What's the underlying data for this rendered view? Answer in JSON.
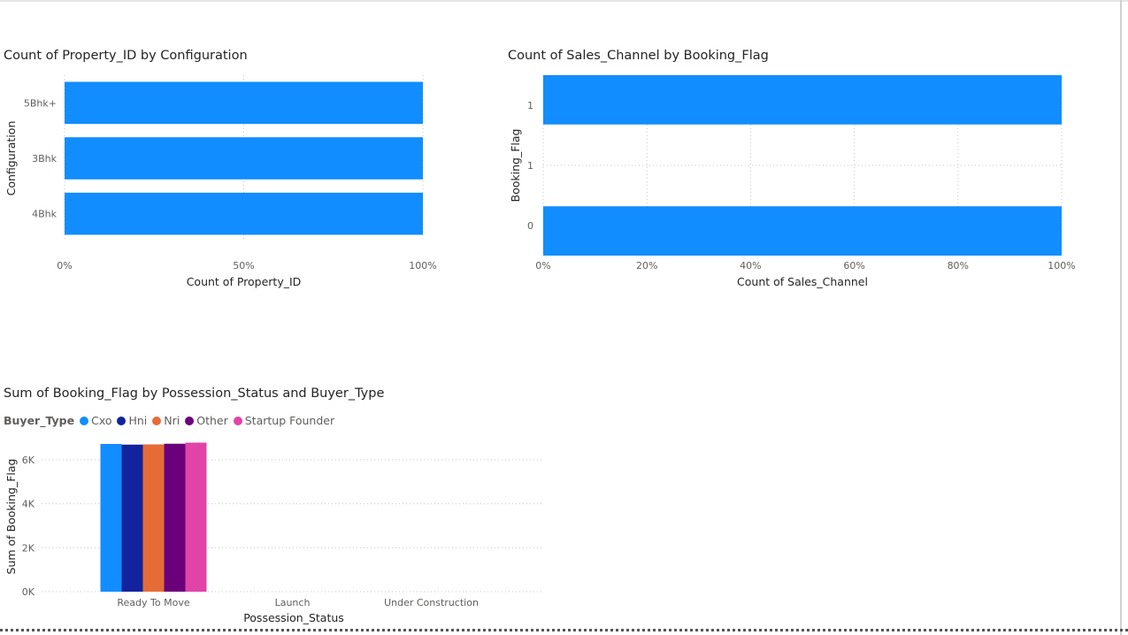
{
  "charts": {
    "c1": {
      "title": "Count of Property_ID by Configuration",
      "xlabel": "Count of Property_ID",
      "ylabel": "Configuration",
      "xticks": [
        "0%",
        "50%",
        "100%"
      ]
    },
    "c2": {
      "title": "Count of Sales_Channel by Booking_Flag",
      "xlabel": "Count of Sales_Channel",
      "ylabel": "Booking_Flag",
      "xticks": [
        "0%",
        "20%",
        "40%",
        "60%",
        "80%",
        "100%"
      ]
    },
    "c3": {
      "title": "Sum of Booking_Flag by Possession_Status and Buyer_Type",
      "xlabel": "Possession_Status",
      "ylabel": "Sum of Booking_Flag",
      "legend_title": "Buyer_Type",
      "yticks": [
        "0K",
        "2K",
        "4K",
        "6K"
      ]
    }
  },
  "chart_data": [
    {
      "type": "bar",
      "orientation": "horizontal",
      "title": "Count of Property_ID by Configuration",
      "xlabel": "Count of Property_ID",
      "ylabel": "Configuration",
      "categories": [
        "5Bhk+",
        "3Bhk",
        "4Bhk"
      ],
      "values": [
        100,
        100,
        100
      ],
      "unit": "%",
      "xlim": [
        0,
        100
      ],
      "color": "#118DFF",
      "grid": true
    },
    {
      "type": "bar",
      "orientation": "horizontal",
      "title": "Count of Sales_Channel by Booking_Flag",
      "xlabel": "Count of Sales_Channel",
      "ylabel": "Booking_Flag",
      "categories": [
        "1",
        "1",
        "0"
      ],
      "values": [
        100,
        null,
        100
      ],
      "unit": "%",
      "xlim": [
        0,
        100
      ],
      "color": "#118DFF",
      "grid": true
    },
    {
      "type": "bar",
      "orientation": "vertical",
      "title": "Sum of Booking_Flag by Possession_Status and Buyer_Type",
      "xlabel": "Possession_Status",
      "ylabel": "Sum of Booking_Flag",
      "categories": [
        "Ready To Move",
        "Launch",
        "Under Construction"
      ],
      "ylim": [
        0,
        6800
      ],
      "legend_placement": "top-left",
      "grid": true,
      "series": [
        {
          "name": "Cxo",
          "color": "#118DFF",
          "values": [
            6720,
            null,
            null
          ]
        },
        {
          "name": "Hni",
          "color": "#12239E",
          "values": [
            6690,
            null,
            null
          ]
        },
        {
          "name": "Nri",
          "color": "#E66C37",
          "values": [
            6700,
            null,
            null
          ]
        },
        {
          "name": "Other",
          "color": "#6B007B",
          "values": [
            6730,
            null,
            null
          ]
        },
        {
          "name": "Startup Founder",
          "color": "#E044A7",
          "values": [
            6780,
            null,
            null
          ]
        }
      ]
    }
  ]
}
